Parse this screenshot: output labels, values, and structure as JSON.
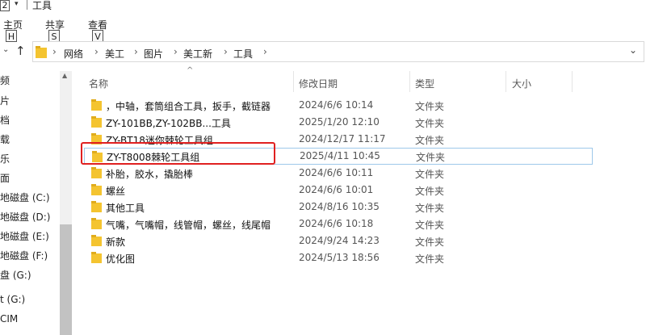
{
  "titlebar": {
    "qat_keytip": "2",
    "title": "工具"
  },
  "ribbon": {
    "tabs": [
      {
        "label": "主页",
        "keytip": "H"
      },
      {
        "label": "共享",
        "keytip": "S"
      },
      {
        "label": "查看",
        "keytip": "V"
      }
    ]
  },
  "addressbar": {
    "crumbs": [
      "网络",
      "美工",
      "图片",
      "美工新",
      "工具"
    ]
  },
  "nav": {
    "items": [
      "频",
      "片",
      "档",
      "载",
      "乐",
      "面",
      "地磁盘 (C:)",
      "地磁盘 (D:)",
      "地磁盘 (E:)",
      "地磁盘 (F:)",
      "盘 (G:)",
      "t (G:)",
      "CIM"
    ]
  },
  "columns": {
    "name": "名称",
    "modified": "修改日期",
    "type": "类型",
    "size": "大小"
  },
  "files": [
    {
      "name": "，中轴，套筒组合工具，扳手，截链器",
      "modified": "2024/6/6 10:14",
      "type": "文件夹"
    },
    {
      "name": "ZY-101BB,ZY-102BB...工具",
      "modified": "2025/1/20 12:10",
      "type": "文件夹"
    },
    {
      "name": "ZY-BT18迷你棘轮工具组",
      "modified": "2024/12/17 11:17",
      "type": "文件夹"
    },
    {
      "name": "ZY-T8008棘轮工具组",
      "modified": "2025/4/11 10:45",
      "type": "文件夹"
    },
    {
      "name": "补胎，胶水，撬胎棒",
      "modified": "2024/6/6 10:11",
      "type": "文件夹"
    },
    {
      "name": "螺丝",
      "modified": "2024/6/6 10:01",
      "type": "文件夹"
    },
    {
      "name": "其他工具",
      "modified": "2024/8/16 10:35",
      "type": "文件夹"
    },
    {
      "name": "气嘴，气嘴帽，线管帽，螺丝，线尾帽",
      "modified": "2024/6/6 10:18",
      "type": "文件夹"
    },
    {
      "name": "新款",
      "modified": "2024/9/24 14:23",
      "type": "文件夹"
    },
    {
      "name": "优化图",
      "modified": "2024/5/13 18:56",
      "type": "文件夹"
    }
  ],
  "colors": {
    "folder": "#f4c430",
    "highlight": "#e02020",
    "selection_border": "#9ec8ea"
  }
}
